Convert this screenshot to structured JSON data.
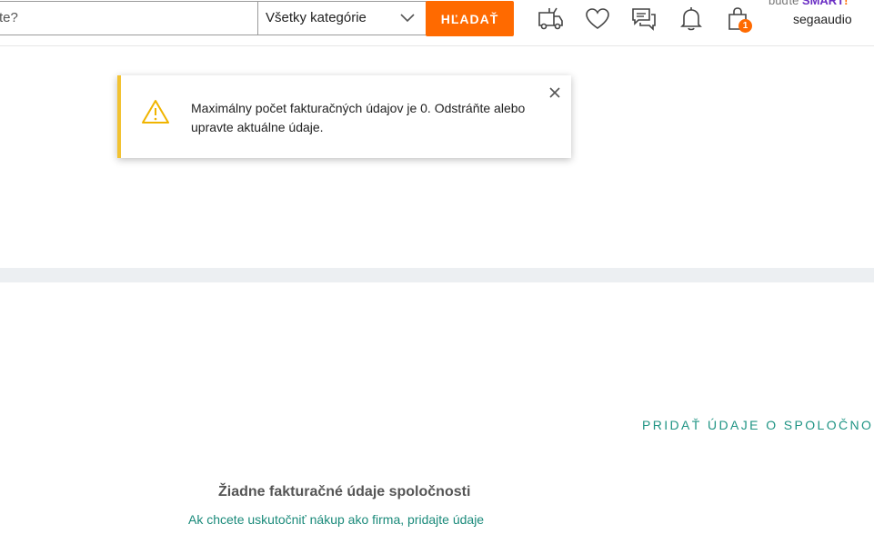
{
  "header": {
    "search_value": "te?",
    "category_selected": "Všetky kategórie",
    "search_button_label": "HĽADAŤ",
    "cart_count": "1",
    "smart_prefix": "buďte",
    "smart_brand": "SMART",
    "smart_mark": "!",
    "username": "segaaudio",
    "accent_color": "#ff6a00"
  },
  "alert": {
    "message": "Maximálny počet fakturačných údajov je 0. Odstráňte alebo upravte aktuálne údaje.",
    "accent_color": "#f2c232"
  },
  "company": {
    "add_link_label": "PRIDAŤ ÚDAJE O SPOLOČNOSTI",
    "empty_title": "Žiadne fakturačné údaje spoločnosti",
    "empty_subtitle": "Ak chcete uskutočniť nákup ako firma, pridajte údaje"
  }
}
